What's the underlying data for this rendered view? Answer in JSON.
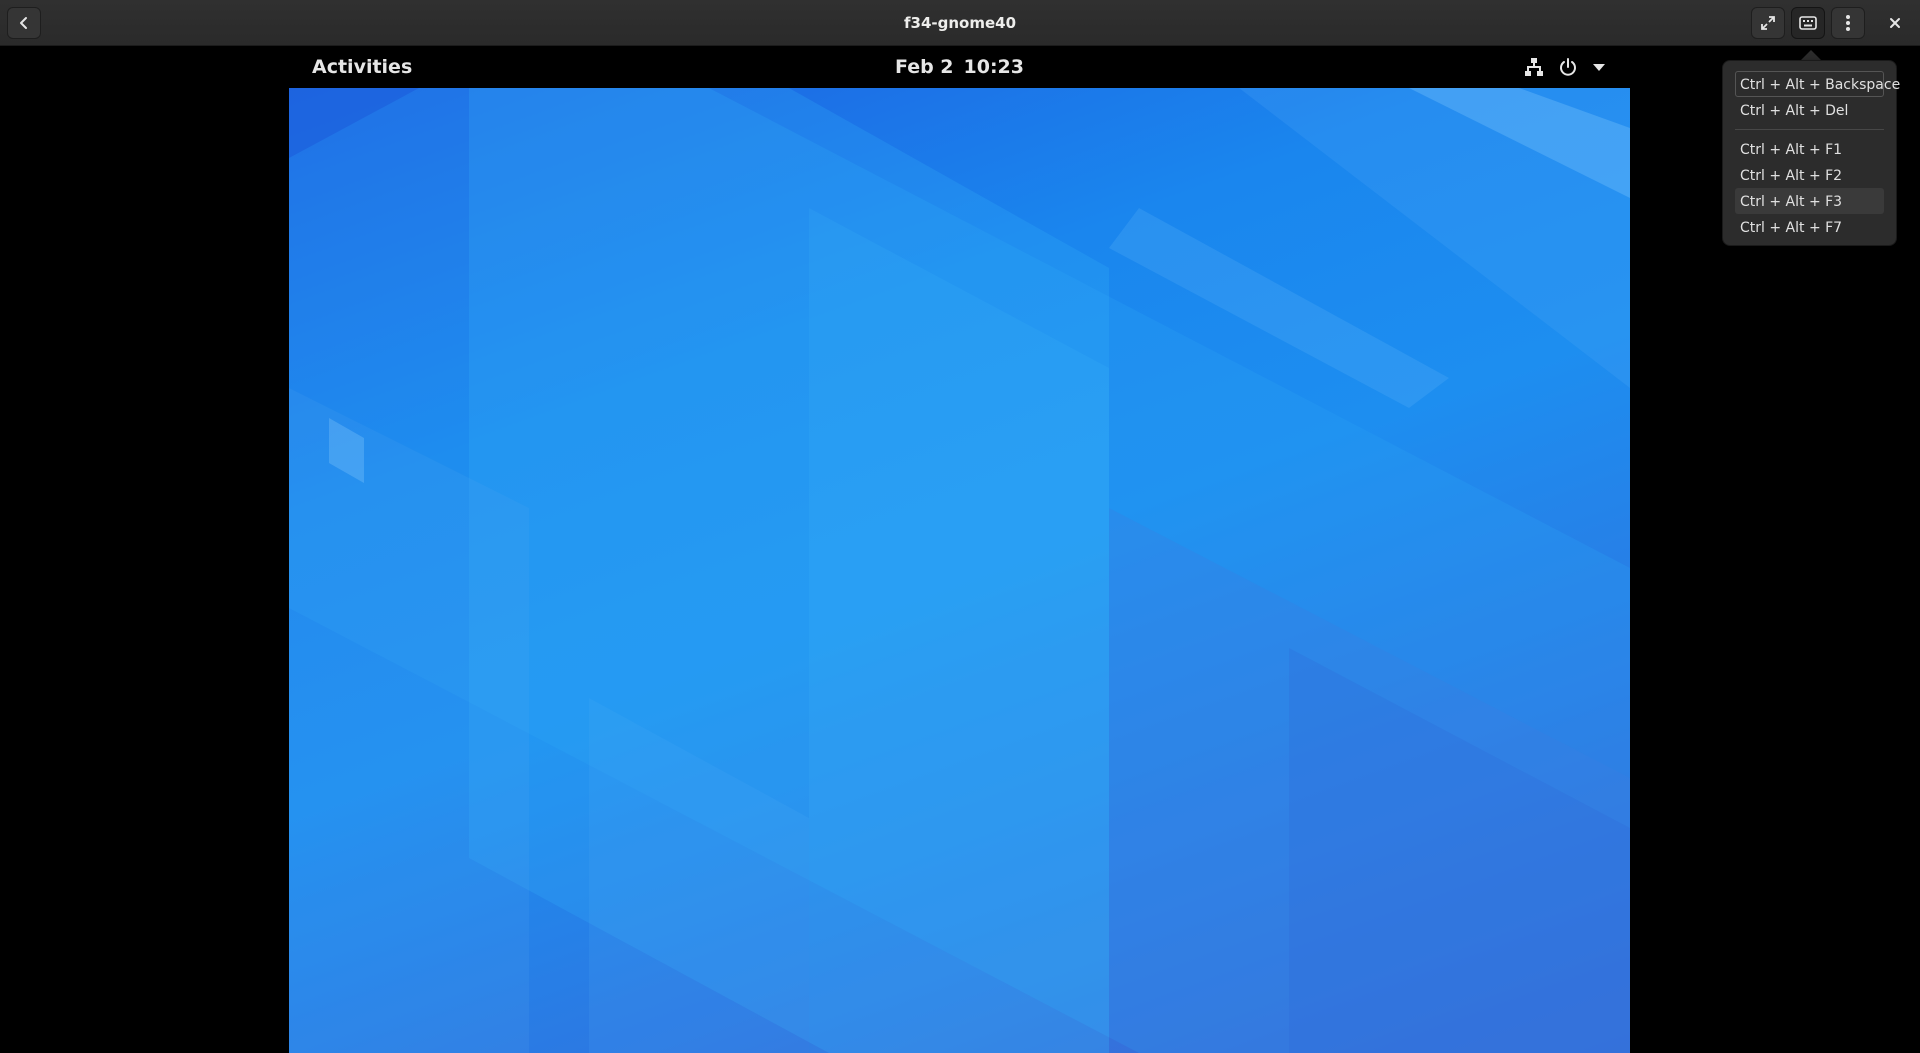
{
  "header": {
    "title": "f34-gnome40",
    "back_icon": "back-arrow-icon",
    "fullscreen_icon": "fullscreen-icon",
    "keyboard_icon": "keyboard-icon",
    "menu_icon": "vertical-dots-icon",
    "close_icon": "close-icon"
  },
  "guest": {
    "activities_label": "Activities",
    "date": "Feb 2",
    "time": "10:23",
    "tray_icons": [
      "network-wired-icon",
      "power-icon",
      "arrow-down-icon"
    ]
  },
  "shortcut_menu": {
    "items": [
      {
        "label": "Ctrl + Alt + Backspace"
      },
      {
        "label": "Ctrl + Alt + Del"
      },
      {
        "label": "Ctrl + Alt + F1"
      },
      {
        "label": "Ctrl + Alt + F2"
      },
      {
        "label": "Ctrl + Alt + F3"
      },
      {
        "label": "Ctrl + Alt + F7"
      }
    ]
  },
  "colors": {
    "headerbar": "#2d2d2d",
    "popover": "#2c2c2c",
    "wallpaper_accent": "#1d8ef0"
  }
}
